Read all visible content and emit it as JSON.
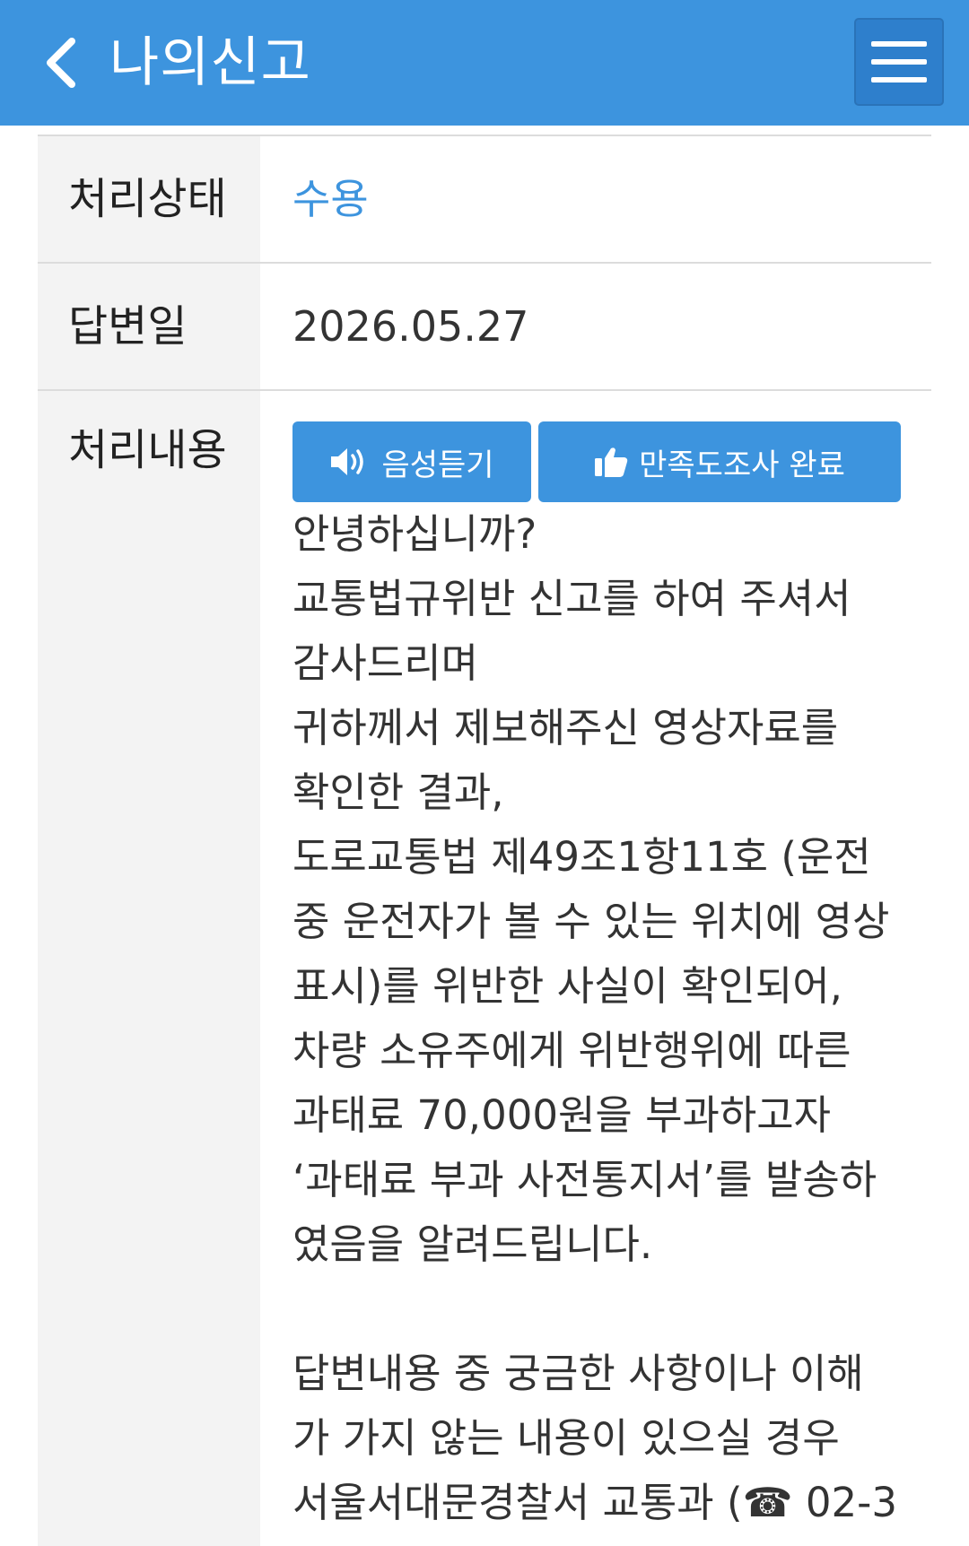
{
  "header": {
    "title": "나의신고"
  },
  "rows": {
    "status": {
      "label": "처리상태",
      "value": "수용"
    },
    "answer_date": {
      "label": "답변일",
      "value": "2026.05.27"
    },
    "content": {
      "label": "처리내용",
      "audio_button": "음성듣기",
      "survey_button": "만족도조사 완료",
      "lines": [
        "안녕하십니까?",
        "교통법규위반 신고를 하여 주셔서",
        "감사드리며",
        "귀하께서 제보해주신 영상자료를",
        "확인한 결과,",
        "도로교통법 제49조1항11호 (운전",
        "중 운전자가 볼 수 있는 위치에 영상",
        "표시)를 위반한 사실이 확인되어,",
        "차량 소유주에게 위반행위에 따른",
        "과태료 70,000원을 부과하고자",
        "‘과태료 부과 사전통지서’를 발송하",
        "였음을 알려드립니다.",
        "",
        "답변내용 중 궁금한 사항이나 이해",
        "가 가지 않는 내용이 있으실 경우",
        "서울서대문경찰서 교통과 (☎ 02-3"
      ]
    }
  },
  "icons": {
    "back": "chevron-left-icon",
    "menu": "hamburger-menu-icon",
    "audio": "speaker-icon",
    "survey": "thumbs-up-icon"
  },
  "colors": {
    "header_bg": "#3d94de",
    "accent": "#3d94de",
    "label_bg": "#f3f3f3"
  }
}
